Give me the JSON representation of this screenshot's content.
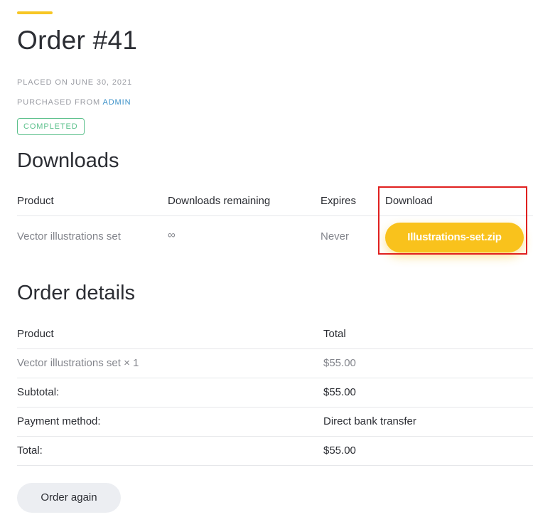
{
  "order": {
    "title": "Order #41",
    "placed_label": "PLACED ON",
    "placed_date": "JUNE 30, 2021",
    "purchased_label": "PURCHASED FROM",
    "purchased_from": "ADMIN",
    "status": "COMPLETED"
  },
  "downloads": {
    "title": "Downloads",
    "headers": {
      "product": "Product",
      "remaining": "Downloads remaining",
      "expires": "Expires",
      "download": "Download"
    },
    "rows": [
      {
        "product": "Vector illustrations set",
        "remaining": "∞",
        "expires": "Never",
        "file": "Illustrations-set.zip"
      }
    ]
  },
  "details": {
    "title": "Order details",
    "headers": {
      "product": "Product",
      "total": "Total"
    },
    "item": {
      "name": "Vector illustrations set × 1",
      "total": "$55.00"
    },
    "subtotal": {
      "label": "Subtotal:",
      "value": "$55.00"
    },
    "payment": {
      "label": "Payment method:",
      "value": "Direct bank transfer"
    },
    "total": {
      "label": "Total:",
      "value": "$55.00"
    }
  },
  "actions": {
    "order_again": "Order again"
  },
  "colors": {
    "accent": "#f7c625",
    "button": "#f9c21c",
    "status": "#5bc08b",
    "link": "#3d92c9",
    "highlight": "#e0201f"
  }
}
